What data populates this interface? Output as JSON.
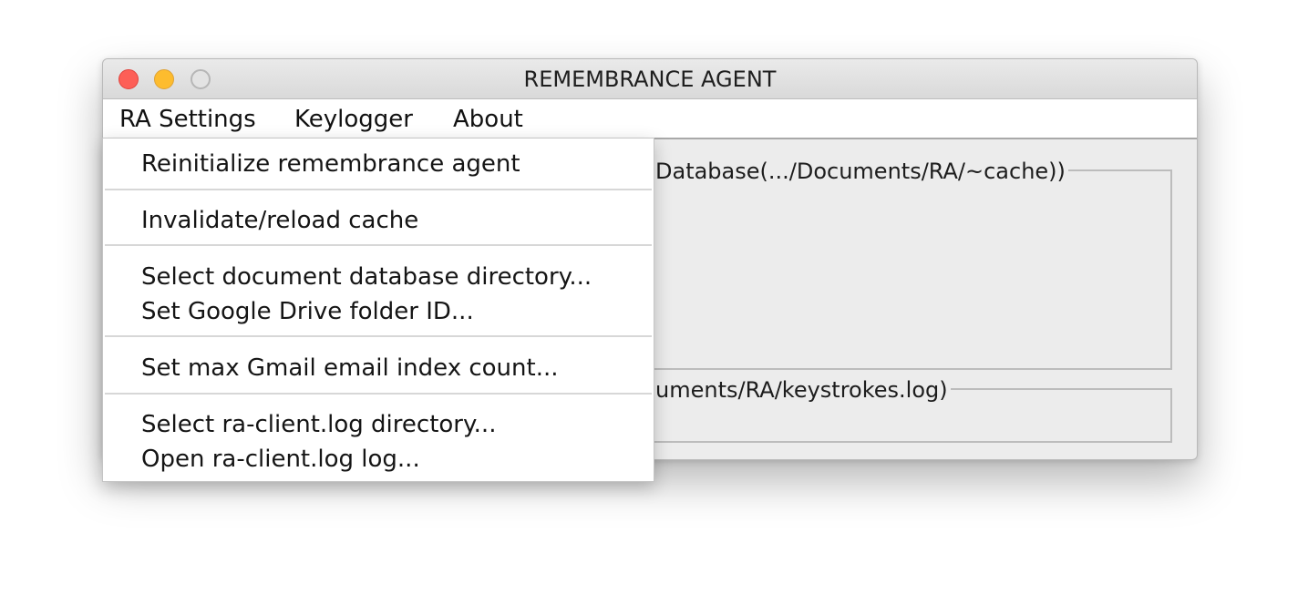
{
  "window": {
    "title": "REMEMBRANCE AGENT"
  },
  "menubar": {
    "items": [
      {
        "label": "RA Settings"
      },
      {
        "label": "Keylogger"
      },
      {
        "label": "About"
      }
    ]
  },
  "panels": {
    "documents_title": "Database(.../Documents/RA/~cache))",
    "keylogger_title": "uments/RA/keystrokes.log)"
  },
  "dropdown": {
    "items": [
      {
        "label": "Reinitialize remembrance agent"
      },
      {
        "label": "Invalidate/reload cache"
      },
      {
        "label": "Select document database directory..."
      },
      {
        "label": "Set Google Drive folder ID..."
      },
      {
        "label": "Set max Gmail email index count..."
      },
      {
        "label": "Select ra-client.log directory..."
      },
      {
        "label": "Open ra-client.log log..."
      }
    ]
  },
  "colors": {
    "close": "#fd5f57",
    "minimize": "#fdbc2e",
    "window_bg": "#ececec"
  }
}
